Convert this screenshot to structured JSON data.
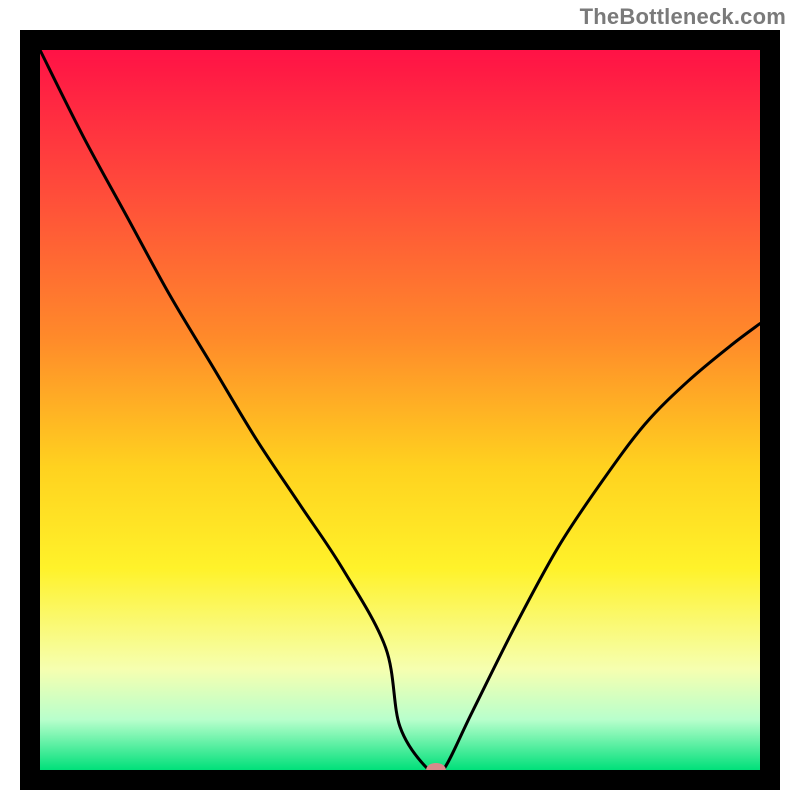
{
  "branding": "TheBottleneck.com",
  "chart_data": {
    "type": "line",
    "title": "",
    "xlabel": "",
    "ylabel": "",
    "xlim": [
      0,
      100
    ],
    "ylim": [
      0,
      100
    ],
    "x": [
      0,
      6,
      12,
      18,
      24,
      30,
      36,
      42,
      48,
      50,
      54,
      56,
      60,
      66,
      72,
      78,
      84,
      90,
      96,
      100
    ],
    "values": [
      100,
      88,
      77,
      66,
      56,
      46,
      37,
      28,
      17,
      6,
      0,
      0,
      8,
      20,
      31,
      40,
      48,
      54,
      59,
      62
    ],
    "marker": {
      "x": 55,
      "y": 0
    },
    "gradient_stops": [
      {
        "offset": 0.0,
        "color": "#ff1246"
      },
      {
        "offset": 0.2,
        "color": "#ff4d3a"
      },
      {
        "offset": 0.4,
        "color": "#ff8a2a"
      },
      {
        "offset": 0.58,
        "color": "#ffd21f"
      },
      {
        "offset": 0.72,
        "color": "#fff22a"
      },
      {
        "offset": 0.86,
        "color": "#f6ffb0"
      },
      {
        "offset": 0.93,
        "color": "#b8ffcc"
      },
      {
        "offset": 1.0,
        "color": "#00e07a"
      }
    ],
    "frame_color": "#000000",
    "frame_width": 20,
    "line_color": "#000000",
    "line_width": 3,
    "marker_color": "#d88b8b"
  }
}
